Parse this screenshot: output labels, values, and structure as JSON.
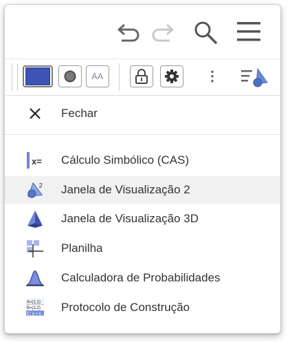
{
  "topbar": {
    "icons": [
      "undo-icon",
      "redo-icon",
      "search-icon",
      "hamburger-menu-icon"
    ]
  },
  "style_bar": {
    "font_size_label": "AA",
    "dots_label": "⋮",
    "color_swatch": "#3d54b5"
  },
  "menu": {
    "close_label": "Fechar",
    "items": [
      {
        "label": "Cálculo Simbólico (CAS)",
        "icon": "cas-icon"
      },
      {
        "label": "Janela de Visualização 2",
        "icon": "graphics2-icon"
      },
      {
        "label": "Janela de Visualização 3D",
        "icon": "graphics3d-icon"
      },
      {
        "label": "Planilha",
        "icon": "spreadsheet-icon"
      },
      {
        "label": "Calculadora de Probabilidades",
        "icon": "probability-icon"
      },
      {
        "label": "Protocolo de Construção",
        "icon": "construction-protocol-icon"
      }
    ],
    "cas_icon_text": "x=",
    "graphics2_superscript": "2",
    "protocol_lines": [
      "A=(1,1)",
      "B=(2,2)",
      "C: y = x"
    ]
  }
}
